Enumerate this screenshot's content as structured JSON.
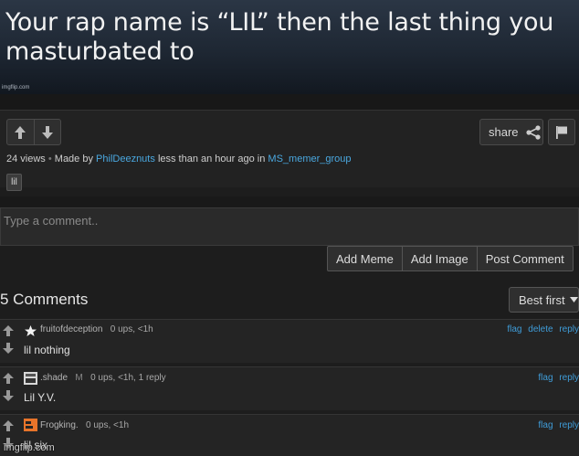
{
  "meme": {
    "caption": "Your rap name is “LIL” then the last thing you masturbated to",
    "watermark_small": "imgflip.com"
  },
  "actions": {
    "share_label": "share",
    "views": "24 views",
    "made_by_label": "Made by",
    "author": "PhilDeeznuts",
    "time": "less than an hour ago in",
    "stream": "MS_memer_group",
    "tag": "lil"
  },
  "comment_box": {
    "placeholder": "Type a comment.."
  },
  "comment_buttons": [
    "Add Meme",
    "Add Image",
    "Post Comment"
  ],
  "comments_header": {
    "count_label": "5 Comments",
    "sort_label": "Best first"
  },
  "comments": [
    {
      "user": "fruitofdeception",
      "badge": "",
      "meta": "0 ups, <1h",
      "text": "lil nothing",
      "links": [
        "flag",
        "delete",
        "reply"
      ]
    },
    {
      "user": ".shade",
      "badge": "M",
      "meta": "0 ups, <1h, 1 reply",
      "text": "Lil Y.V.",
      "links": [
        "flag",
        "reply"
      ]
    },
    {
      "user": "Frogking.",
      "badge": "",
      "meta": "0 ups, <1h",
      "text": "lil six",
      "links": [
        "flag",
        "reply"
      ]
    }
  ],
  "footer": {
    "watermark": "imgflip.com"
  },
  "colors": {
    "link": "#4aa8e0",
    "background": "#1d1d1d",
    "accent_orange": "#e8742a"
  }
}
